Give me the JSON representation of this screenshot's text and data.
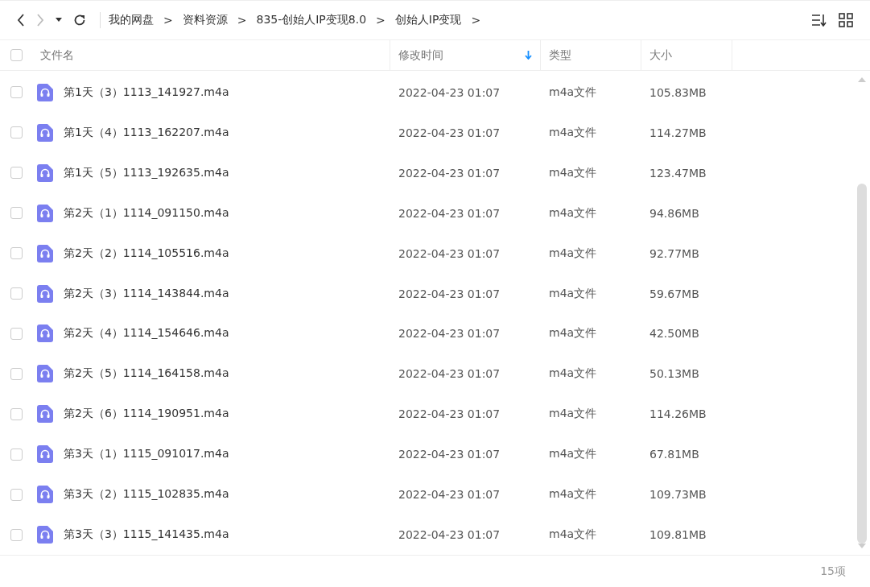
{
  "toolbar": {
    "breadcrumbs": [
      "我的网盘",
      "资料资源",
      "835-创始人IP变现8.0",
      "创始人IP变现"
    ],
    "separator": ">"
  },
  "table": {
    "select_all": {
      "checked": false
    },
    "columns": [
      {
        "label": "文件名",
        "sorted": false
      },
      {
        "label": "修改时间",
        "sorted": true
      },
      {
        "label": "类型",
        "sorted": false
      },
      {
        "label": "大小",
        "sorted": false
      }
    ],
    "rows": [
      {
        "name": "第1天（3）1113_141927.m4a",
        "modified": "2022-04-23 01:07",
        "type": "m4a文件",
        "size": "105.83MB",
        "checked": false
      },
      {
        "name": "第1天（4）1113_162207.m4a",
        "modified": "2022-04-23 01:07",
        "type": "m4a文件",
        "size": "114.27MB",
        "checked": false
      },
      {
        "name": "第1天（5）1113_192635.m4a",
        "modified": "2022-04-23 01:07",
        "type": "m4a文件",
        "size": "123.47MB",
        "checked": false
      },
      {
        "name": "第2天（1）1114_091150.m4a",
        "modified": "2022-04-23 01:07",
        "type": "m4a文件",
        "size": "94.86MB",
        "checked": false
      },
      {
        "name": "第2天（2）1114_105516.m4a",
        "modified": "2022-04-23 01:07",
        "type": "m4a文件",
        "size": "92.77MB",
        "checked": false
      },
      {
        "name": "第2天（3）1114_143844.m4a",
        "modified": "2022-04-23 01:07",
        "type": "m4a文件",
        "size": "59.67MB",
        "checked": false
      },
      {
        "name": "第2天（4）1114_154646.m4a",
        "modified": "2022-04-23 01:07",
        "type": "m4a文件",
        "size": "42.50MB",
        "checked": false
      },
      {
        "name": "第2天（5）1114_164158.m4a",
        "modified": "2022-04-23 01:07",
        "type": "m4a文件",
        "size": "50.13MB",
        "checked": false
      },
      {
        "name": "第2天（6）1114_190951.m4a",
        "modified": "2022-04-23 01:07",
        "type": "m4a文件",
        "size": "114.26MB",
        "checked": false
      },
      {
        "name": "第3天（1）1115_091017.m4a",
        "modified": "2022-04-23 01:07",
        "type": "m4a文件",
        "size": "67.81MB",
        "checked": false
      },
      {
        "name": "第3天（2）1115_102835.m4a",
        "modified": "2022-04-23 01:07",
        "type": "m4a文件",
        "size": "109.73MB",
        "checked": false
      },
      {
        "name": "第3天（3）1115_141435.m4a",
        "modified": "2022-04-23 01:07",
        "type": "m4a文件",
        "size": "109.81MB",
        "checked": false
      }
    ]
  },
  "footer": {
    "count": "15项"
  }
}
